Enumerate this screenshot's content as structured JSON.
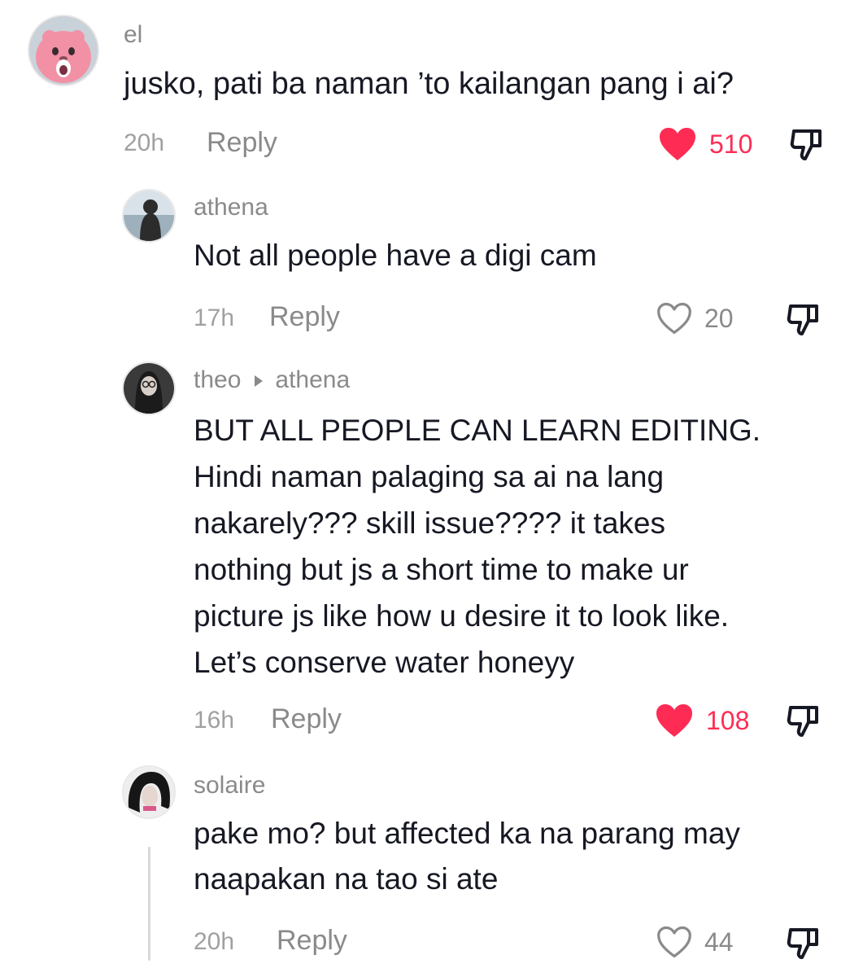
{
  "comments": [
    {
      "username": "el",
      "lines": [
        "jusko, pati ba naman ’to kailangan pang i ai?"
      ],
      "time": "20h",
      "reply_label": "Reply",
      "likes": "510",
      "liked": true
    },
    {
      "username": "athena",
      "lines": [
        "Not all people have a digi cam"
      ],
      "time": "17h",
      "reply_label": "Reply",
      "likes": "20",
      "liked": false
    },
    {
      "username": "theo",
      "reply_to": "athena",
      "lines": [
        "BUT ALL PEOPLE CAN LEARN EDITING.",
        "Hindi naman palaging sa ai na lang",
        "nakarely??? skill issue???? it takes",
        "nothing but js a short time to make ur",
        "picture js like how u desire it to look like.",
        "Let’s conserve water honeyy"
      ],
      "time": "16h",
      "reply_label": "Reply",
      "likes": "108",
      "liked": true
    },
    {
      "username": "solaire",
      "lines": [
        "pake mo? but affected ka na parang may",
        "naapakan na tao si ate"
      ],
      "time": "20h",
      "reply_label": "Reply",
      "likes": "44",
      "liked": false
    }
  ],
  "icons": {
    "like_filled": "heart-filled-icon",
    "like_outline": "heart-outline-icon",
    "dislike": "thumbs-down-icon",
    "reply_arrow": "triangle-right-icon"
  },
  "colors": {
    "liked": "#fe2c55",
    "muted": "#8a8a8a",
    "timestamp": "#a0a0a0",
    "text": "#161823"
  }
}
